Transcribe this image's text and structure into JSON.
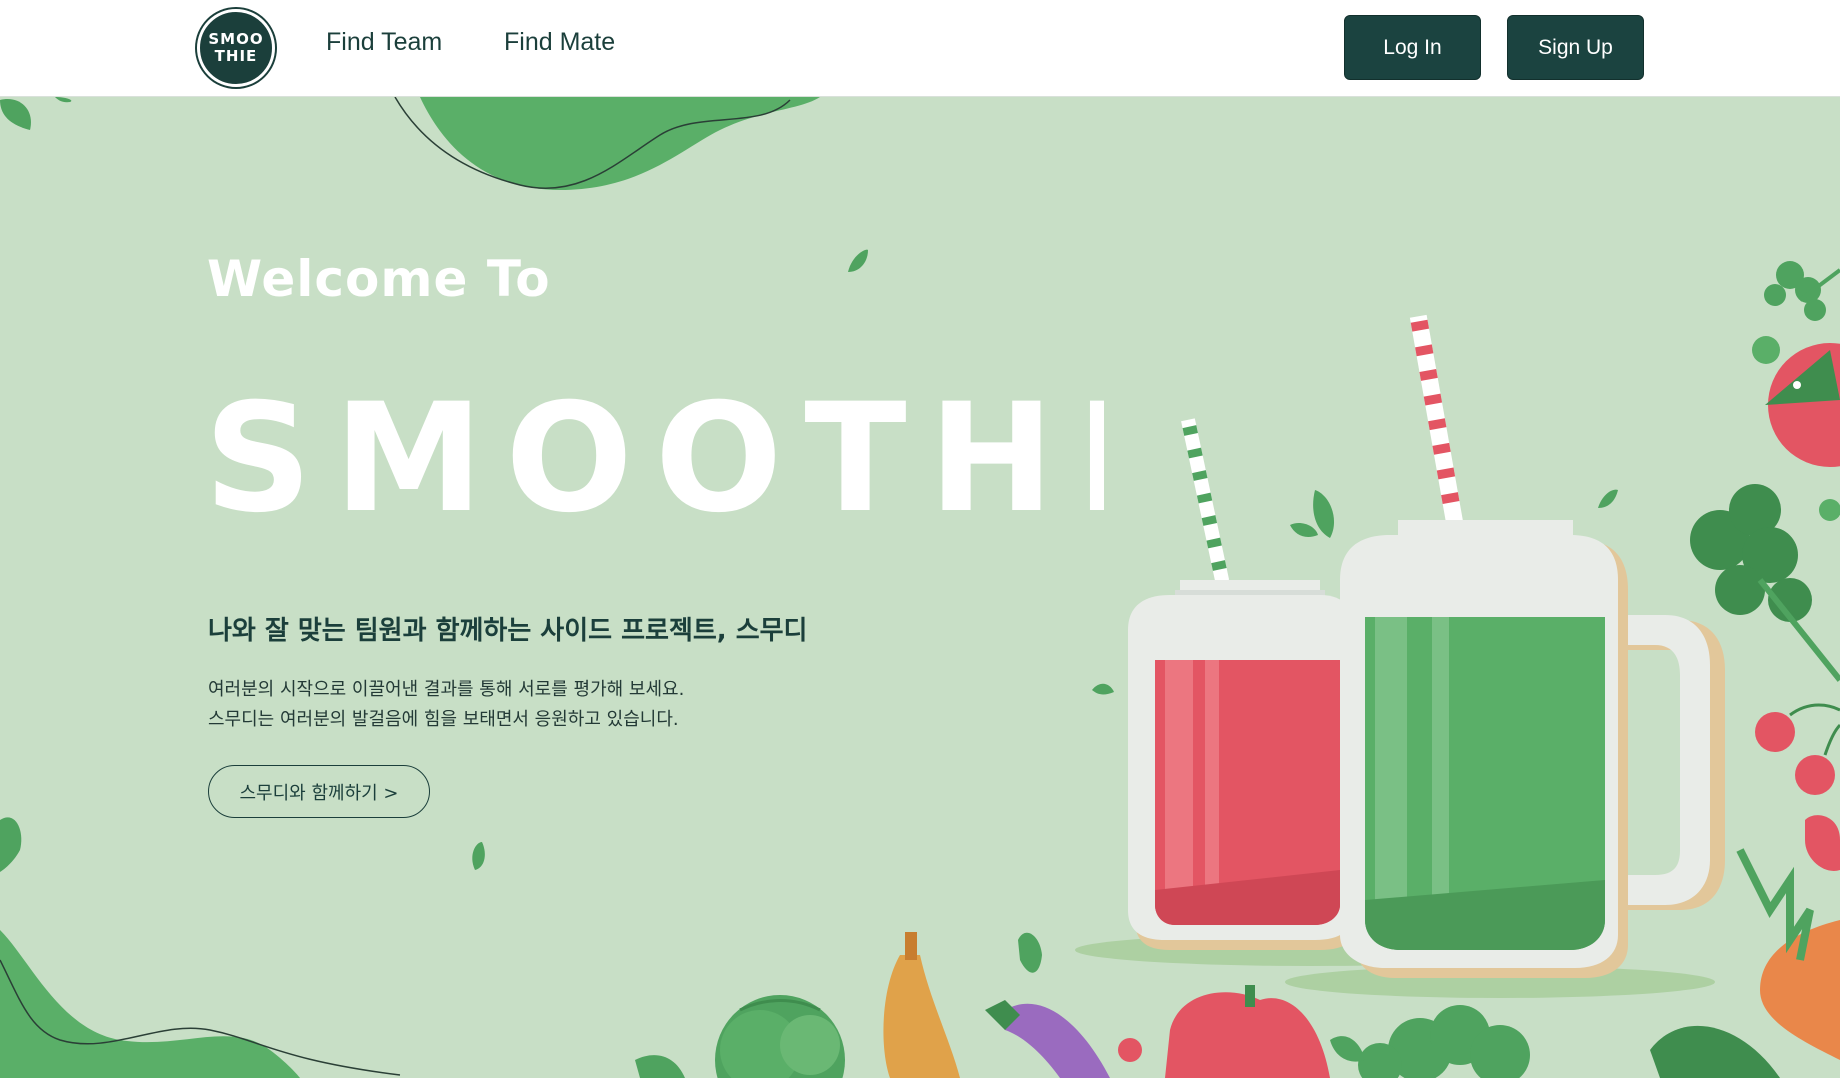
{
  "header": {
    "logo_text_line1": "SMOO",
    "logo_text_line2": "THIE",
    "nav": [
      {
        "label": "Find Team"
      },
      {
        "label": "Find Mate"
      }
    ],
    "login_label": "Log In",
    "signup_label": "Sign Up"
  },
  "hero": {
    "welcome": "Welcome To",
    "brand": "SMOOTHIE",
    "subtitle": "나와 잘 맞는 팀원과 함께하는 사이드 프로젝트, 스무디",
    "description_line1": "여러분의 시작으로 이끌어낸 결과를 통해 서로를 평가해 보세요.",
    "description_line2": "스무디는 여러분의 발걸음에 힘을 보태면서 응원하고 있습니다.",
    "cta_label": "스무디와 함께하기 >"
  },
  "colors": {
    "primary": "#1b4340",
    "background": "#c8dfc6",
    "leaf": "#5aaf68",
    "red_juice": "#e35563",
    "green_juice": "#5aaf68"
  },
  "icons": [
    "logo-icon",
    "leaf-icon",
    "jar-icon",
    "straw-icon",
    "tomato-icon",
    "cherry-icon",
    "carrot-icon",
    "eggplant-icon",
    "pepper-icon",
    "broccoli-icon",
    "cabbage-icon",
    "banana-icon"
  ]
}
